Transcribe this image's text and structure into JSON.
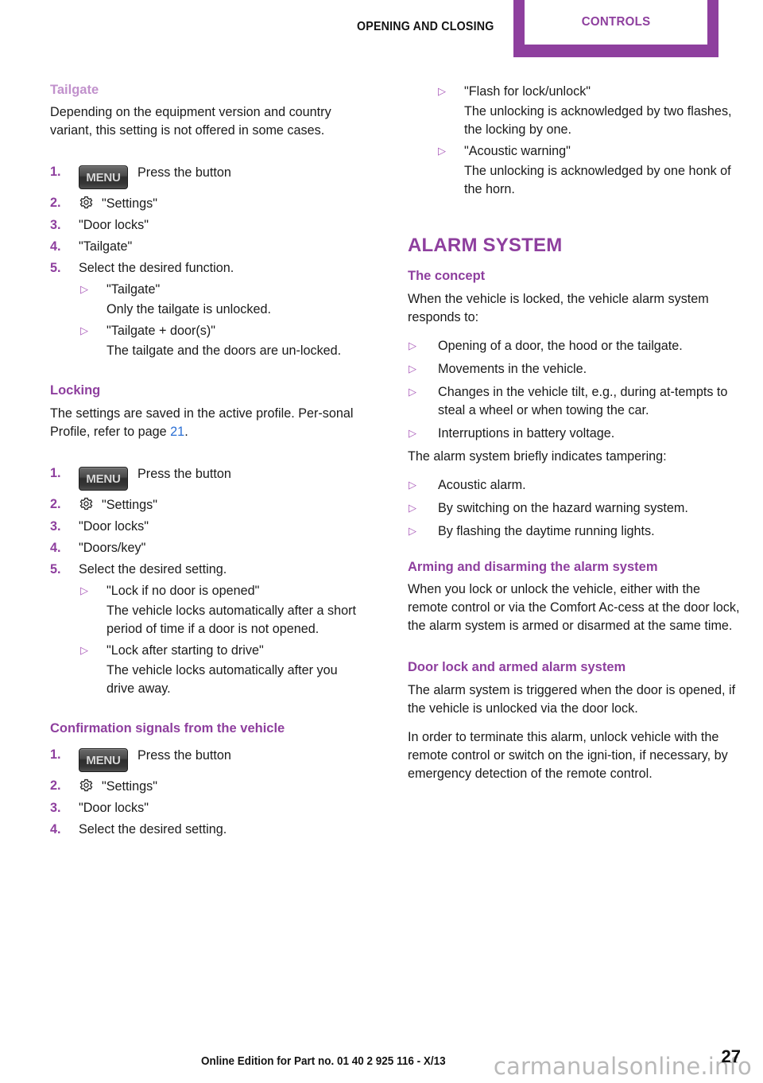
{
  "header": {
    "chapter": "OPENING AND CLOSING",
    "tab_label": "CONTROLS",
    "accent_color": "#8e3f9e"
  },
  "left_column": {
    "tailgate": {
      "heading": "Tailgate",
      "intro": "Depending on the equipment version and country variant, this setting is not offered in some cases.",
      "steps": [
        {
          "num": "1.",
          "button": "MENU",
          "text": "Press the button"
        },
        {
          "num": "2.",
          "icon": "gear-icon",
          "text": "\"Settings\""
        },
        {
          "num": "3.",
          "text": "\"Door locks\""
        },
        {
          "num": "4.",
          "text": "\"Tailgate\""
        },
        {
          "num": "5.",
          "text": "Select the desired function."
        }
      ],
      "sub_items": [
        {
          "marker": "▷",
          "label": "\"Tailgate\"",
          "desc": "Only the tailgate is unlocked."
        },
        {
          "marker": "▷",
          "label": "\"Tailgate + door(s)\"",
          "desc": "The tailgate and the doors are un-locked."
        }
      ]
    },
    "locking": {
      "heading": "Locking",
      "intro_before": "The settings are saved in the active profile. Per-sonal Profile, refer to page ",
      "intro_xref": "21",
      "intro_after": ".",
      "steps": [
        {
          "num": "1.",
          "button": "MENU",
          "text": "Press the button"
        },
        {
          "num": "2.",
          "icon": "gear-icon",
          "text": "\"Settings\""
        },
        {
          "num": "3.",
          "text": "\"Door locks\""
        },
        {
          "num": "4.",
          "text": "\"Doors/key\""
        },
        {
          "num": "5.",
          "text": "Select the desired setting."
        }
      ],
      "sub_items": [
        {
          "marker": "▷",
          "label": "\"Lock if no door is opened\"",
          "desc": "The vehicle locks automatically after a short period of time if a door is not opened."
        },
        {
          "marker": "▷",
          "label": "\"Lock after starting to drive\"",
          "desc": "The vehicle locks automatically after you drive away."
        }
      ]
    },
    "confirmation": {
      "heading": "Confirmation signals from the vehicle",
      "steps": [
        {
          "num": "1.",
          "button": "MENU",
          "text": "Press the button"
        },
        {
          "num": "2.",
          "icon": "gear-icon",
          "text": "\"Settings\""
        },
        {
          "num": "3.",
          "text": "\"Door locks\""
        },
        {
          "num": "4.",
          "text": "Select the desired setting."
        }
      ]
    }
  },
  "right_column": {
    "confirmation_continued": {
      "sub_items": [
        {
          "marker": "▷",
          "label": "\"Flash for lock/unlock\"",
          "desc": "The unlocking is acknowledged by two flashes, the locking by one."
        },
        {
          "marker": "▷",
          "label": "\"Acoustic warning\"",
          "desc": "The unlocking is acknowledged by one honk of the horn."
        }
      ]
    },
    "alarm_system": {
      "title": "ALARM SYSTEM",
      "concept": {
        "heading": "The concept",
        "intro": "When the vehicle is locked, the vehicle alarm system responds to:",
        "bullets": [
          {
            "marker": "▷",
            "text": "Opening of a door, the hood or the tailgate."
          },
          {
            "marker": "▷",
            "text": "Movements in the vehicle."
          },
          {
            "marker": "▷",
            "text": "Changes in the vehicle tilt, e.g., during at-tempts to steal a wheel or when towing the car."
          },
          {
            "marker": "▷",
            "text": "Interruptions in battery voltage."
          }
        ],
        "tamper_intro": "The alarm system briefly indicates tampering:",
        "tamper_bullets": [
          {
            "marker": "▷",
            "text": "Acoustic alarm."
          },
          {
            "marker": "▷",
            "text": "By switching on the hazard warning system."
          },
          {
            "marker": "▷",
            "text": "By flashing the daytime running lights."
          }
        ]
      },
      "arming": {
        "heading": "Arming and disarming the alarm system",
        "body": "When you lock or unlock the vehicle, either with the remote control or via the Comfort Ac-cess at the door lock, the alarm system is armed or disarmed at the same time."
      },
      "door_lock": {
        "heading": "Door lock and armed alarm system",
        "body1": "The alarm system is triggered when the door is opened, if the vehicle is unlocked via the door lock.",
        "body2": "In order to terminate this alarm, unlock vehicle with the remote control or switch on the igni-tion, if necessary, by emergency detection of the remote control."
      }
    }
  },
  "footer": {
    "edition": "Online Edition for Part no. 01 40 2 925 116 - X/13",
    "page_number": "27",
    "watermark": "carmanualsonline.info"
  }
}
